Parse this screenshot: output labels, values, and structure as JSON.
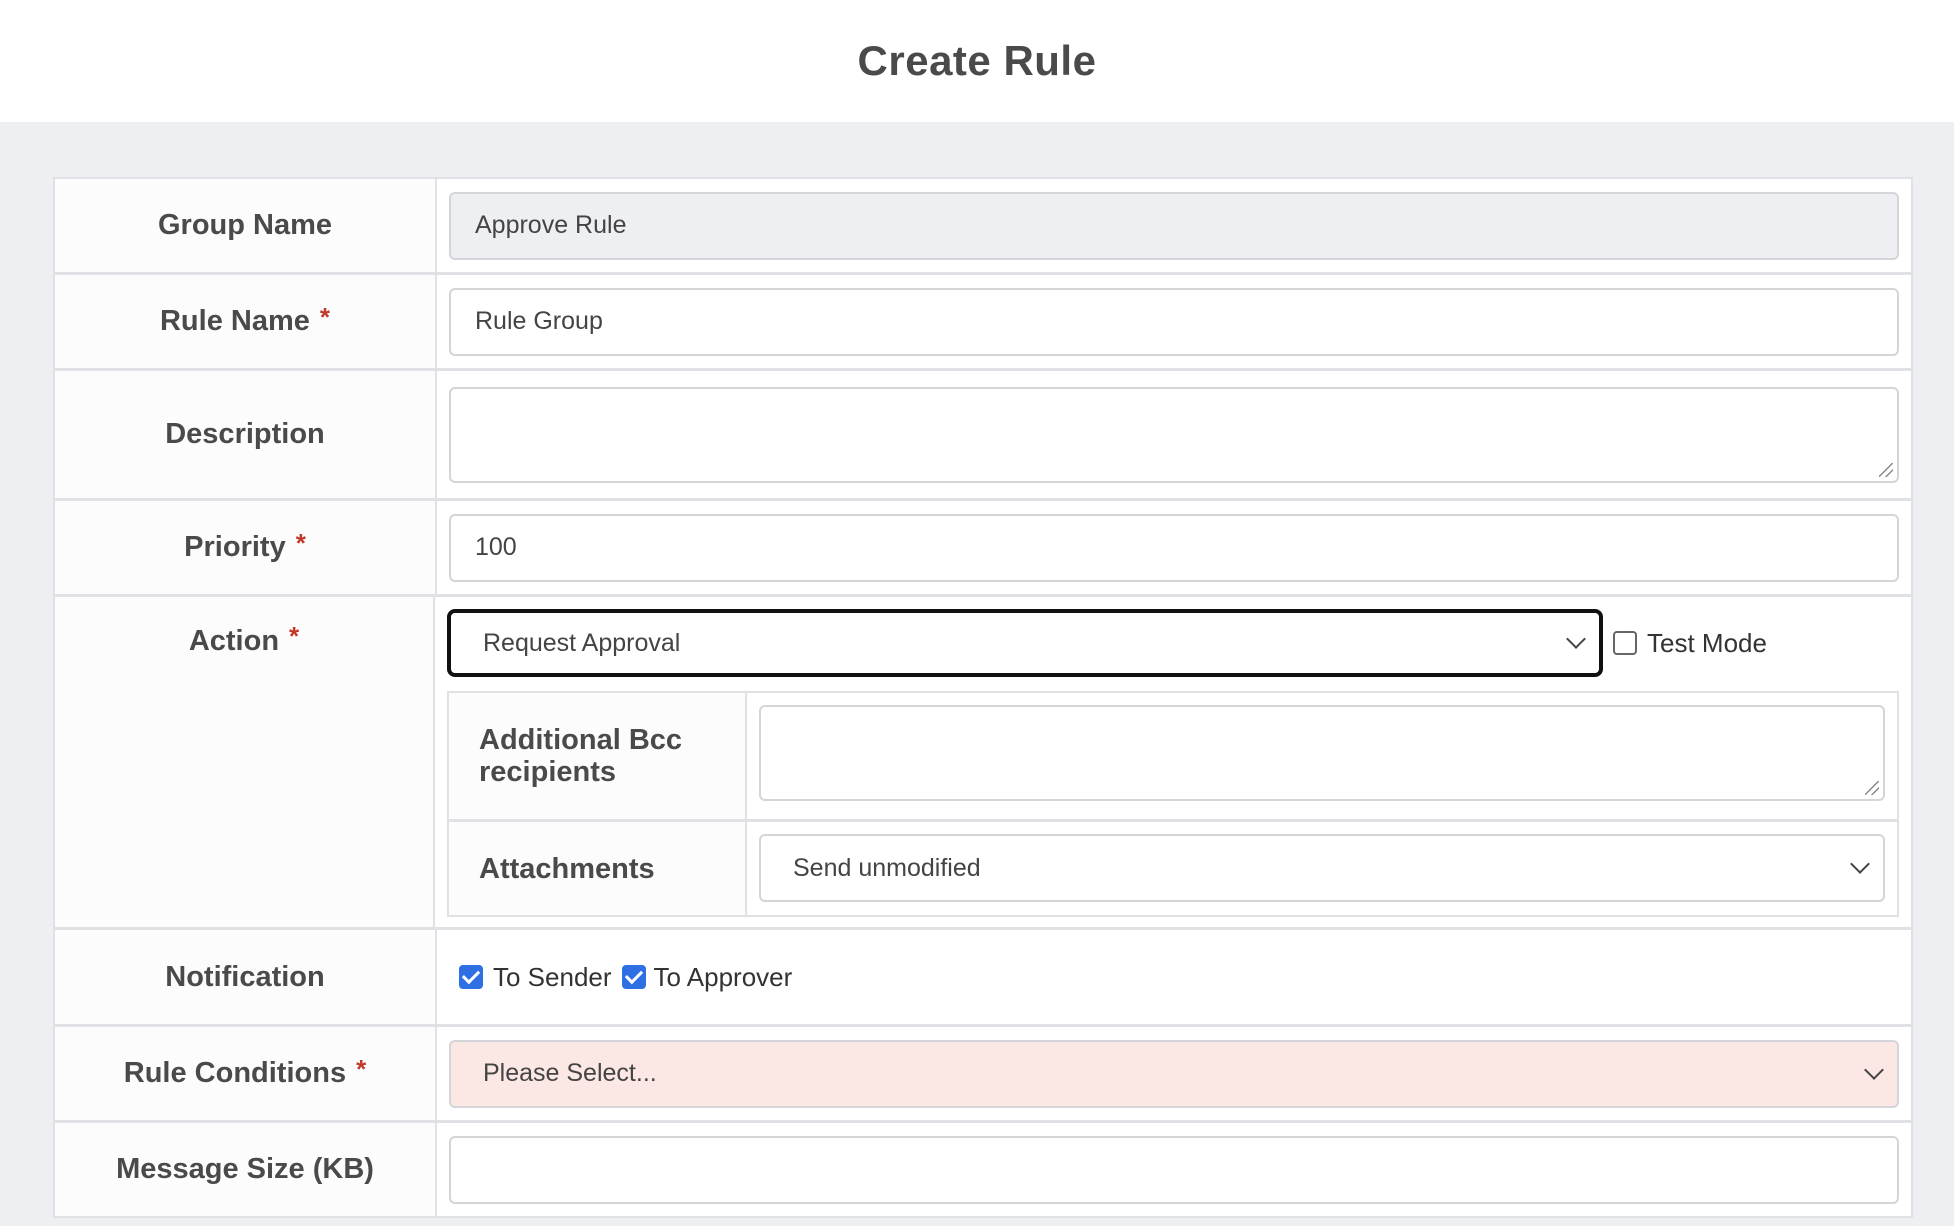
{
  "page": {
    "title": "Create Rule"
  },
  "form": {
    "group_name": {
      "label": "Group Name",
      "value": "Approve Rule"
    },
    "rule_name": {
      "label": "Rule Name",
      "required": "*",
      "value": "Rule Group"
    },
    "description": {
      "label": "Description",
      "value": ""
    },
    "priority": {
      "label": "Priority",
      "required": "*",
      "value": "100"
    },
    "action": {
      "label": "Action",
      "required": "*",
      "selected": "Request Approval",
      "test_mode_label": "Test Mode",
      "test_mode_checked": false,
      "bcc": {
        "label": "Additional Bcc recipients",
        "value": ""
      },
      "attachments": {
        "label": "Attachments",
        "selected": "Send unmodified"
      }
    },
    "notification": {
      "label": "Notification",
      "to_sender": "To Sender",
      "to_sender_checked": true,
      "to_approver": "To Approver",
      "to_approver_checked": true
    },
    "rule_conditions": {
      "label": "Rule Conditions",
      "required": "*",
      "placeholder": "Please Select..."
    },
    "message_size": {
      "label": "Message Size (KB)",
      "value": ""
    }
  },
  "colors": {
    "accent": "#2f6fe4",
    "required": "#c0392b",
    "invalid_bg": "#fbe7e3"
  }
}
